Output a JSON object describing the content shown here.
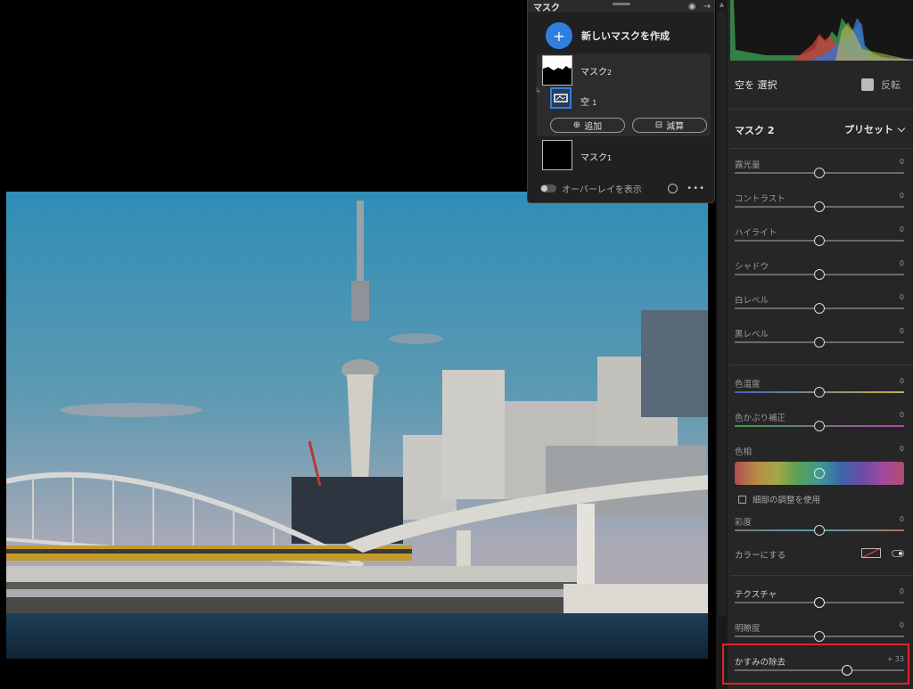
{
  "mask_panel": {
    "title": "マスク",
    "create_label": "新しいマスクを作成",
    "masks": [
      {
        "name": "マスク",
        "num": "2",
        "selected": true
      },
      {
        "name": "空",
        "num": "1",
        "is_component": true
      },
      {
        "name": "マスク",
        "num": "1"
      }
    ],
    "add_label": "追加",
    "subtract_label": "減算",
    "overlay_label": "オーバーレイを表示"
  },
  "right_panel": {
    "select_sky_label": "空を 選択",
    "invert_label": "反転",
    "section_title": "マスク 2",
    "preset_label": "プリセット",
    "sliders": {
      "exposure": {
        "label": "露光量",
        "value": "0",
        "level": 0.5
      },
      "contrast": {
        "label": "コントラスト",
        "value": "0",
        "level": 0.5
      },
      "highlights": {
        "label": "ハイライト",
        "value": "0",
        "level": 0.5
      },
      "shadows": {
        "label": "シャドウ",
        "value": "0",
        "level": 0.5
      },
      "whites": {
        "label": "白レベル",
        "value": "0",
        "level": 0.5
      },
      "blacks": {
        "label": "黒レベル",
        "value": "0",
        "level": 0.5
      },
      "temp": {
        "label": "色温度",
        "value": "0",
        "level": 0.5
      },
      "tint": {
        "label": "色かぶり補正",
        "value": "0",
        "level": 0.5
      },
      "hue": {
        "label": "色相",
        "value": "0",
        "level": 0.5
      },
      "saturation": {
        "label": "彩度",
        "value": "0",
        "level": 0.5
      },
      "texture": {
        "label": "テクスチャ",
        "value": "0",
        "level": 0.5
      },
      "clarity": {
        "label": "明瞭度",
        "value": "0",
        "level": 0.5
      },
      "dehaze": {
        "label": "かすみの除去",
        "value": "+ 33",
        "level": 0.665
      }
    },
    "fine_adjust_label": "細部の調整を使用",
    "colorize_label": "カラーにする"
  },
  "colors": {
    "accent": "#2f7fe0",
    "highlight_box": "#e0242c",
    "panel_bg": "#262626"
  }
}
